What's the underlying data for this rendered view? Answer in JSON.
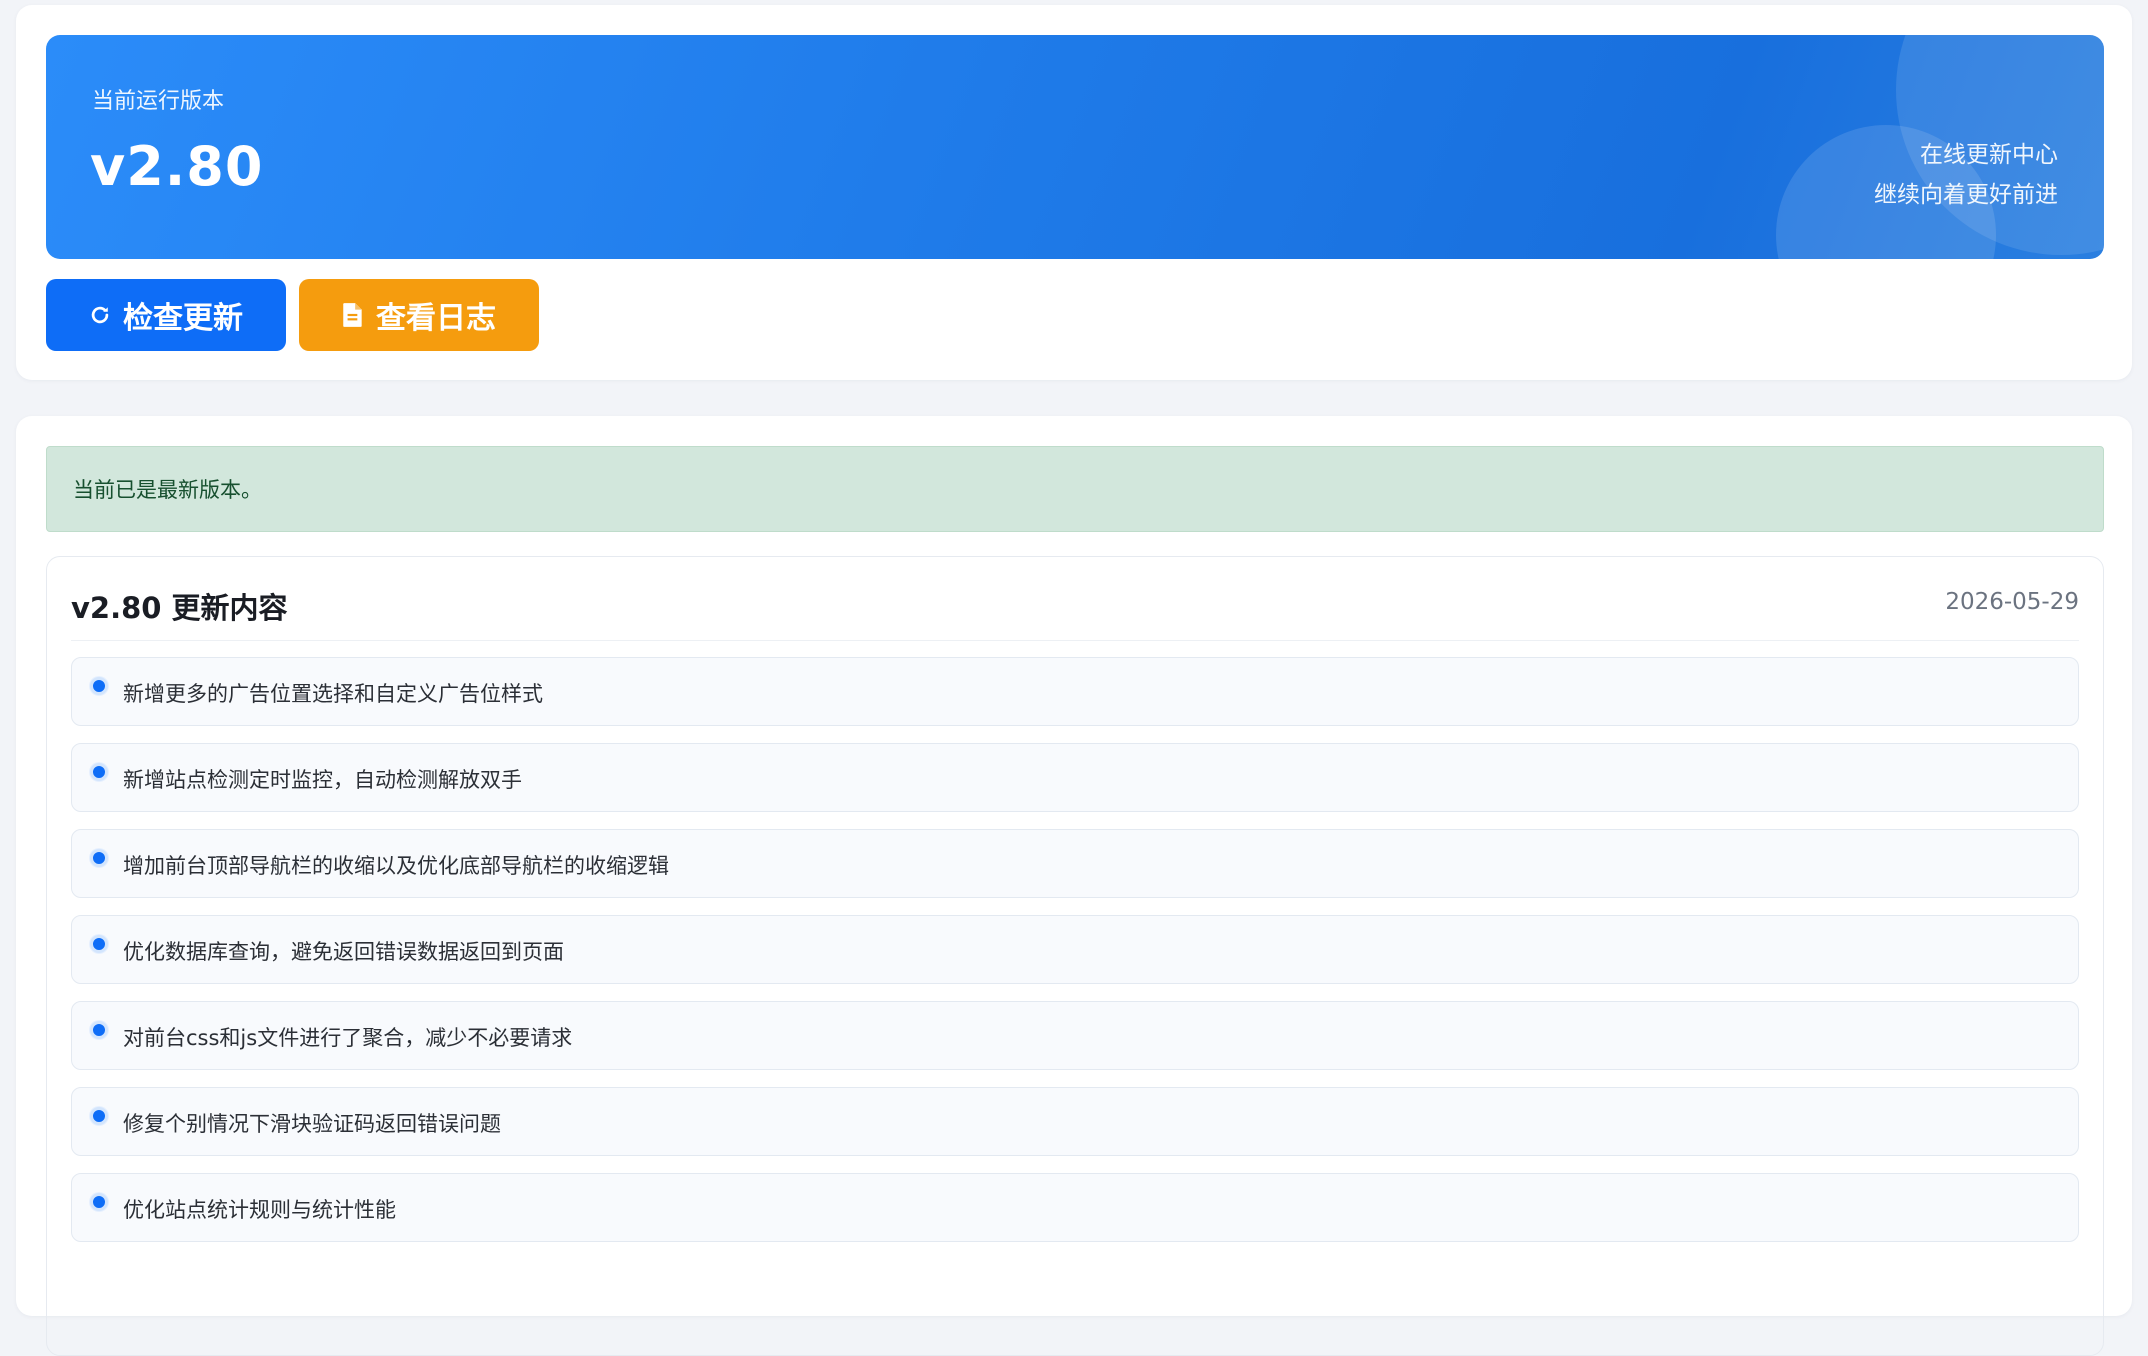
{
  "banner": {
    "label": "当前运行版本",
    "version": "v2.80",
    "right_line1": "在线更新中心",
    "right_line2": "继续向着更好前进"
  },
  "actions": {
    "check_label": "检查更新",
    "check_icon": "refresh-icon",
    "log_label": "查看日志",
    "log_icon": "document-icon"
  },
  "alert": {
    "message": "当前已是最新版本。"
  },
  "changelog": {
    "title": "v2.80 更新内容",
    "date": "2026-05-29",
    "items": [
      "新增更多的广告位置选择和自定义广告位样式",
      "新增站点检测定时监控，自动检测解放双手",
      "增加前台顶部导航栏的收缩以及优化底部导航栏的收缩逻辑",
      "优化数据库查询，避免返回错误数据返回到页面",
      "对前台css和js文件进行了聚合，减少不必要请求",
      "修复个别情况下滑块验证码返回错误问题",
      "优化站点统计规则与统计性能"
    ]
  },
  "colors": {
    "primary": "#0e6df7",
    "warning": "#f59c0e",
    "success_bg": "#d2e7dc",
    "success_text": "#17502f",
    "page_bg": "#f2f4f8"
  }
}
